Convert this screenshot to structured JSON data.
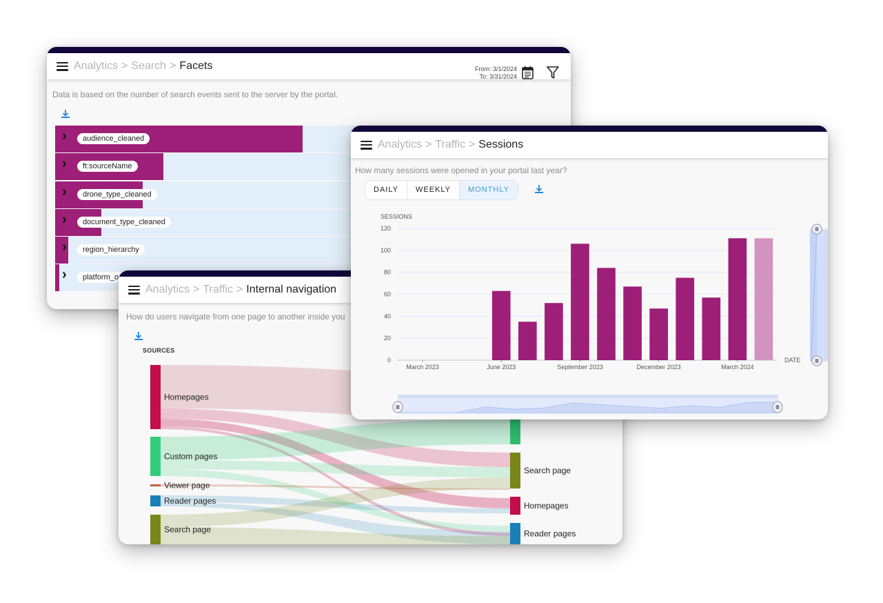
{
  "facets_panel": {
    "breadcrumb": [
      "Analytics",
      "Search"
    ],
    "separator": ">",
    "title": "Facets",
    "date_from": "From: 3/1/2024",
    "date_to": "To: 3/31/2024",
    "description": "Data is based on the number of search events sent to the server by the portal.",
    "facets": [
      {
        "name": "audience_cleaned",
        "share": 0.48
      },
      {
        "name": "ft:sourceName",
        "share": 0.21
      },
      {
        "name": "drone_type_cleaned",
        "share": 0.17
      },
      {
        "name": "document_type_cleaned",
        "share": 0.09
      },
      {
        "name": "region_hierarchy",
        "share": 0.025
      },
      {
        "name": "platform_o",
        "share": 0.008
      }
    ],
    "colors": {
      "bar": "#9d1f78",
      "track": "#e2eef9"
    }
  },
  "sessions_panel": {
    "breadcrumb": [
      "Analytics",
      "Traffic"
    ],
    "separator": ">",
    "title": "Sessions",
    "description": "How many sessions were opened in your portal last year?",
    "granularity": [
      "DAILY",
      "WEEKLY",
      "MONTHLY"
    ],
    "granularity_selected": "MONTHLY"
  },
  "navigation_panel": {
    "breadcrumb": [
      "Analytics",
      "Traffic"
    ],
    "separator": ">",
    "title": "Internal navigation",
    "description": "How do users navigate from one page to another inside you",
    "sources_label": "SOURCES",
    "sources": [
      {
        "name": "Homepages",
        "color": "#c20e4a"
      },
      {
        "name": "Custom pages",
        "color": "#33cc7a"
      },
      {
        "name": "Viewer page",
        "color": "#c0643c"
      },
      {
        "name": "Reader pages",
        "color": "#1b7fb8"
      },
      {
        "name": "Search page",
        "color": "#7a861a"
      }
    ],
    "targets": [
      {
        "name": "",
        "color": "#2fbf70"
      },
      {
        "name": "Search page",
        "color": "#7a861a"
      },
      {
        "name": "Homepages",
        "color": "#c20e4a"
      },
      {
        "name": "Reader pages",
        "color": "#1b7fb8"
      }
    ]
  },
  "chart_data": {
    "type": "bar",
    "title": "",
    "ylabel": "SESSIONS",
    "xlabel": "DATE",
    "ylim": [
      0,
      120
    ],
    "yticks": [
      0,
      20,
      40,
      60,
      80,
      100,
      120
    ],
    "xtick_labels": [
      "March 2023",
      "June 2023",
      "September 2023",
      "December 2023",
      "March 2024"
    ],
    "categories": [
      "March 2023",
      "April 2023",
      "May 2023",
      "June 2023",
      "July 2023",
      "August 2023",
      "September 2023",
      "October 2023",
      "November 2023",
      "December 2023",
      "January 2024",
      "February 2024",
      "March 2024",
      "April 2024"
    ],
    "values": [
      0,
      0,
      0,
      63,
      35,
      52,
      106,
      84,
      67,
      47,
      75,
      57,
      111,
      111
    ],
    "highlight_last": true,
    "grid": true,
    "colors": {
      "bar": "#9d1f78",
      "bar_partial": "#d393c2",
      "grid": "#e4e8f5"
    }
  }
}
